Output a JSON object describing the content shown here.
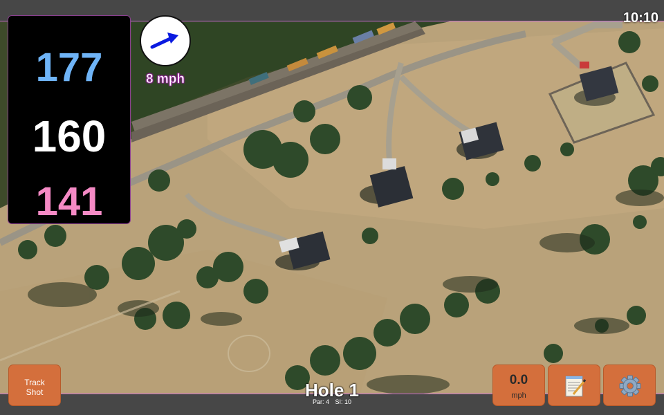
{
  "clock": {
    "time": "10:10"
  },
  "yardage": {
    "back": "177",
    "middle": "160",
    "front": "141"
  },
  "wind": {
    "speed_label": "8 mph",
    "icon": "wind-arrow-icon"
  },
  "track_button": {
    "line1": "Track",
    "line2": "Shot"
  },
  "hole": {
    "title": "Hole 1",
    "par": "Par: 4",
    "si": "SI: 10"
  },
  "speed_button": {
    "value": "0.0",
    "unit": "mph"
  },
  "notes_button": {
    "icon": "notepad-icon"
  },
  "settings_button": {
    "icon": "gear-icon"
  },
  "colors": {
    "back_yardage": "#6fb4f7",
    "middle_yardage": "#ffffff",
    "front_yardage": "#f58ac5",
    "button": "#d46f3c",
    "bar": "#474747",
    "accent": "#c76ad0"
  }
}
